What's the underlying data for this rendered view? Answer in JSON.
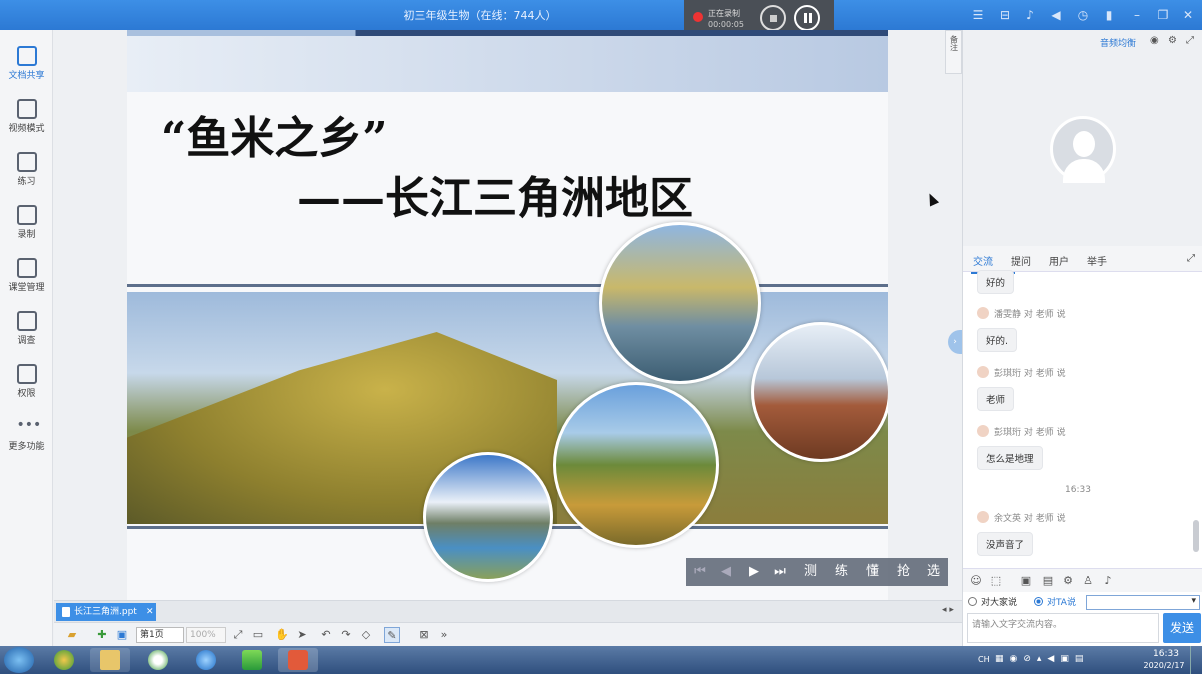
{
  "titlebar": {
    "title": "初三年级生物（在线：744人）",
    "recording": {
      "status": "正在录制",
      "time": "00:00:05"
    }
  },
  "sidebar": {
    "items": [
      {
        "label": "文档共享",
        "icon": "document-share-icon",
        "active": true
      },
      {
        "label": "视频模式",
        "icon": "video-mode-icon"
      },
      {
        "label": "练习",
        "icon": "exercise-icon"
      },
      {
        "label": "录制",
        "icon": "record-icon"
      },
      {
        "label": "课堂管理",
        "icon": "class-management-icon"
      },
      {
        "label": "调查",
        "icon": "survey-icon"
      },
      {
        "label": "权限",
        "icon": "permission-icon"
      },
      {
        "label": "更多功能",
        "icon": "more-icon"
      }
    ]
  },
  "slide": {
    "title_line1": "“鱼米之乡”",
    "title_line2": "——长江三角洲地区"
  },
  "notes_tab": {
    "label": "备注"
  },
  "player": {
    "buttons": [
      "测",
      "练",
      "懂",
      "抢",
      "选"
    ]
  },
  "right_panel": {
    "av_balance": "音频均衡"
  },
  "chat": {
    "tabs": [
      "交流",
      "提问",
      "用户",
      "举手"
    ],
    "active_tab": "交流",
    "messages": [
      {
        "sender": "",
        "text": "好的"
      },
      {
        "sender": "潘雯静 对 老师 说",
        "text": "好的."
      },
      {
        "sender": "彭琪珩 对 老师 说",
        "text": "老师"
      },
      {
        "sender": "彭琪珩 对 老师 说",
        "text": "怎么是地理"
      },
      {
        "sender": "余文英 对 老师 说",
        "text": "没声音了"
      }
    ],
    "timestamp": "16:33",
    "to_all": "对大家说",
    "to_ta": "对TA说",
    "input_placeholder": "请输入文字交流内容。",
    "send": "发送"
  },
  "doc_tab": {
    "name": "长江三角洲.ppt"
  },
  "bottombar": {
    "page": "第1页",
    "zoom": "100%"
  },
  "taskbar": {
    "lang": "CH",
    "time": "16:33",
    "date": "2020/2/17"
  },
  "colors": {
    "accent": "#2c79d4",
    "titlebar": "#3d8fe6"
  }
}
